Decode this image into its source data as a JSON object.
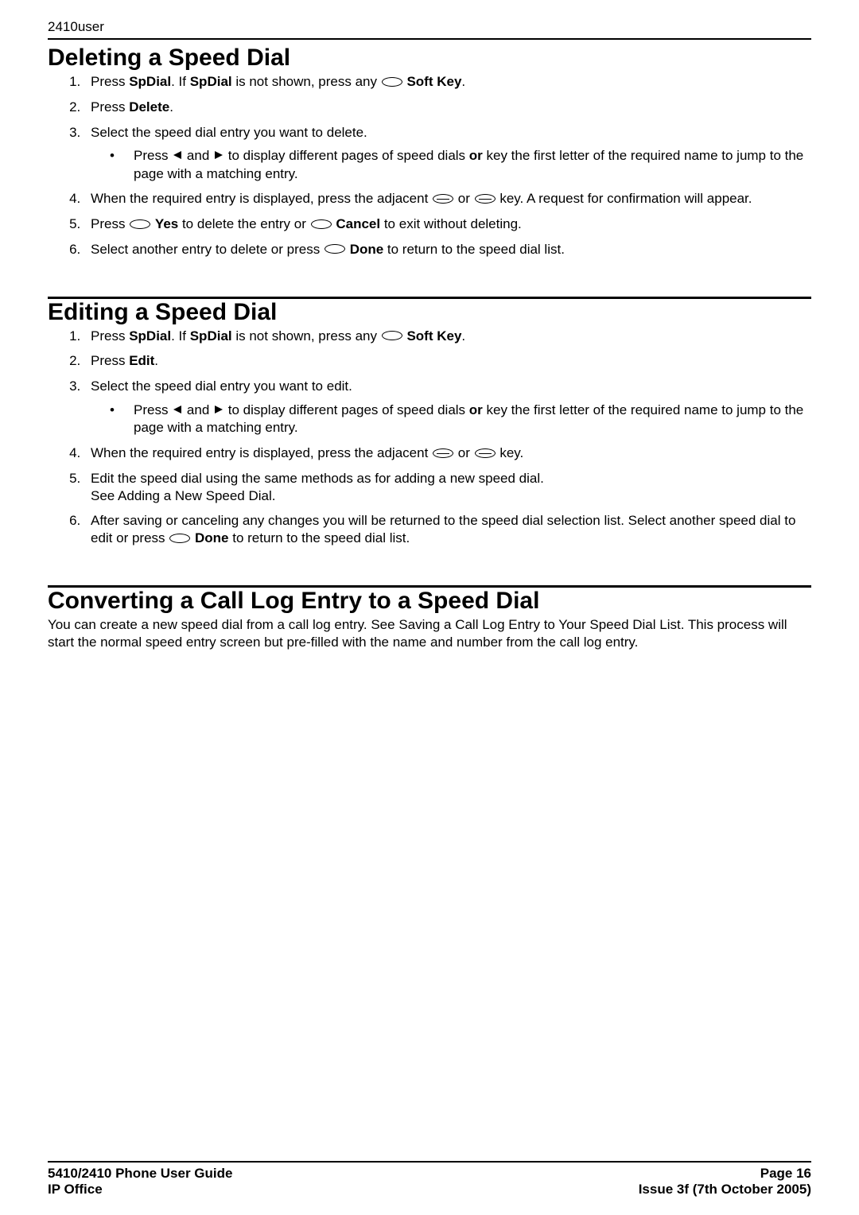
{
  "meta": {
    "header_doc": "2410user"
  },
  "section1": {
    "heading": "Deleting a Speed Dial",
    "step1_a": "Press ",
    "step1_b": "SpDial",
    "step1_c": ". If ",
    "step1_d": "SpDial",
    "step1_e": " is not shown, press any ",
    "step1_f": "Soft Key",
    "step1_g": ".",
    "step2_a": "Press ",
    "step2_b": "Delete",
    "step2_c": ".",
    "step3": "Select the speed dial entry you want to delete.",
    "step3b_a": "Press ",
    "step3b_b": " and ",
    "step3b_c": " to display different pages of speed dials ",
    "step3b_or": "or",
    "step3b_d": " key the first letter of the required name to jump to the page with a matching entry.",
    "step4_a": "When the required entry is displayed, press the adjacent ",
    "step4_b": " or ",
    "step4_c": " key. A request for confirmation will appear.",
    "step5_a": "Press ",
    "step5_yes": "Yes",
    "step5_b": " to delete the entry or ",
    "step5_cancel": "Cancel",
    "step5_c": " to exit without deleting.",
    "step6_a": "Select another entry to delete or press ",
    "step6_done": "Done",
    "step6_b": " to return to the speed dial list."
  },
  "section2": {
    "heading": "Editing a Speed Dial",
    "step1_a": "Press ",
    "step1_b": "SpDial",
    "step1_c": ". If ",
    "step1_d": "SpDial",
    "step1_e": " is not shown, press any ",
    "step1_f": "Soft Key",
    "step1_g": ".",
    "step2_a": "Press ",
    "step2_b": "Edit",
    "step2_c": ".",
    "step3": "Select the speed dial entry you want to edit.",
    "step3b_a": "Press ",
    "step3b_b": " and ",
    "step3b_c": " to display different pages of speed dials ",
    "step3b_or": "or",
    "step3b_d": " key the first letter of the required name to jump to the page with a matching entry.",
    "step4_a": "When the required entry is displayed, press the adjacent ",
    "step4_b": " or ",
    "step4_c": " key.",
    "step5_a": "Edit the speed dial using the same methods as for adding a new speed dial.",
    "step5_b": "See Adding a New Speed Dial.",
    "step6_a": "After saving or canceling any changes you will be returned to the speed dial selection list. Select another speed dial to edit or press ",
    "step6_done": "Done",
    "step6_b": " to return to the speed dial list."
  },
  "section3": {
    "heading": "Converting a Call Log Entry to a Speed Dial",
    "para": "You can create a new speed dial from a call log entry. See Saving a Call Log Entry to Your Speed Dial List. This process will start the normal speed entry screen but pre-filled with the name and number from the call log entry."
  },
  "footer": {
    "left1": "5410/2410 Phone User Guide",
    "right1": "Page 16",
    "left2": "IP Office",
    "right2": "Issue 3f (7th October 2005)"
  }
}
